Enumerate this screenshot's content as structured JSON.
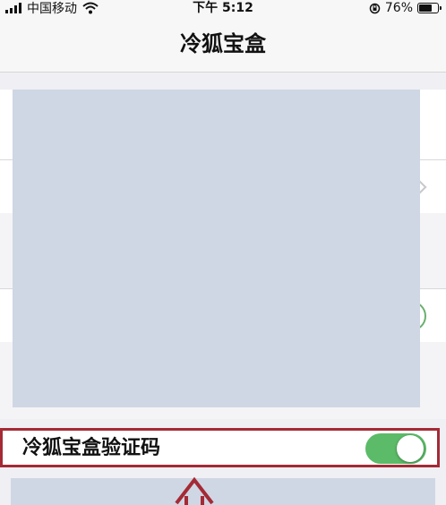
{
  "status_bar": {
    "carrier": "中国移动",
    "time": "下午 5:12",
    "battery_percent": "76%",
    "battery_level": 0.76,
    "icons": [
      "signal-icon",
      "wifi-icon",
      "orientation-lock-icon",
      "battery-icon"
    ]
  },
  "nav": {
    "title": "冷狐宝盒"
  },
  "settings": {
    "verification_label": "冷狐宝盒验证码",
    "verification_enabled": true
  },
  "colors": {
    "toggle_on": "#5cbb68",
    "highlight_border": "#a42a35",
    "redaction": "#cfd7e4",
    "background": "#efeff4"
  }
}
